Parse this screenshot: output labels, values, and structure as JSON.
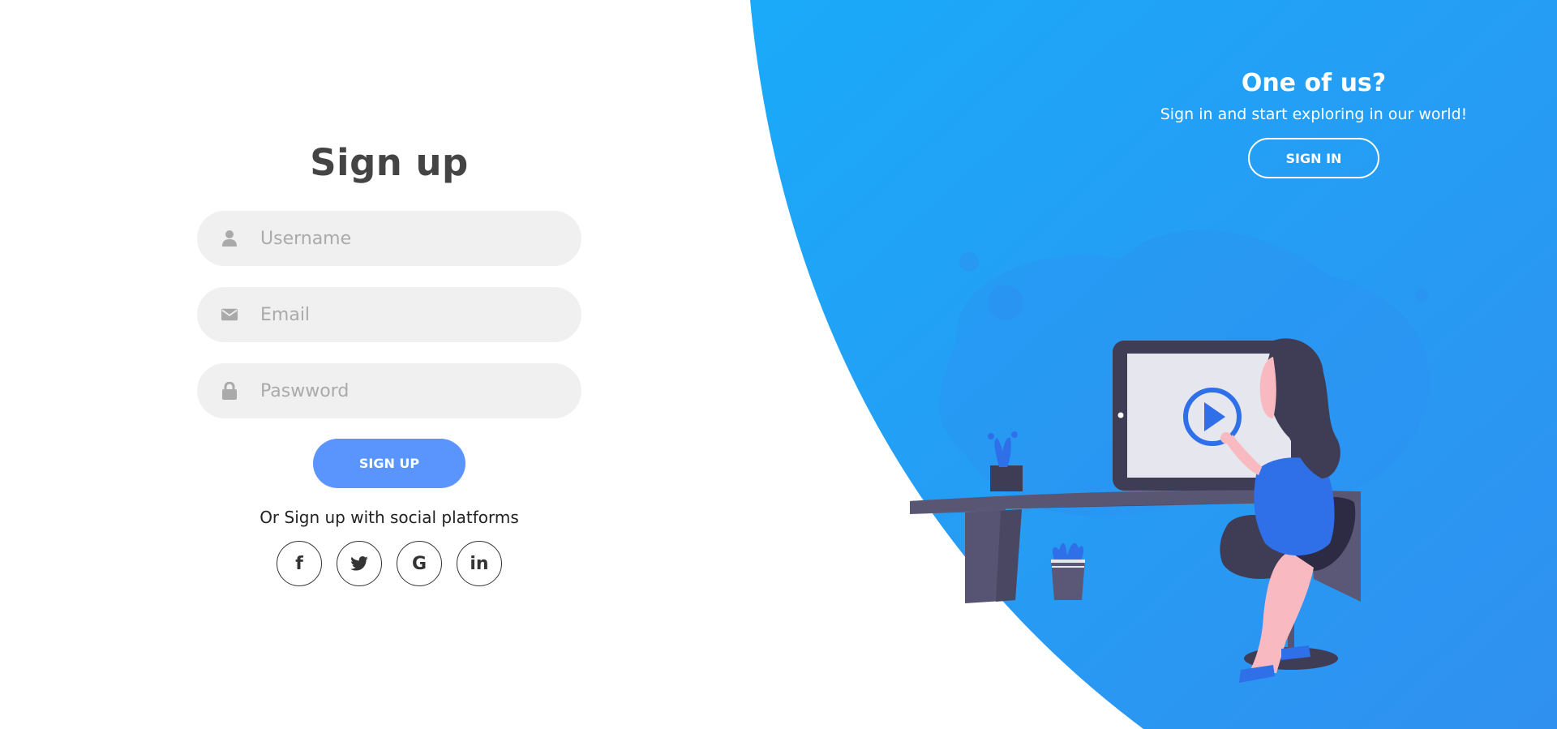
{
  "signup": {
    "title": "Sign up",
    "username_placeholder": "Username",
    "email_placeholder": "Email",
    "password_placeholder": "Paswword",
    "submit_label": "SIGN UP",
    "social_text": "Or Sign up with social platforms",
    "social": [
      {
        "name": "facebook",
        "glyph": "f"
      },
      {
        "name": "twitter",
        "glyph": ""
      },
      {
        "name": "google",
        "glyph": "G"
      },
      {
        "name": "linkedin",
        "glyph": "in"
      }
    ]
  },
  "panel": {
    "title": "One of us?",
    "subtitle": "Sign in and start exploring in our world!",
    "signin_label": "SIGN IN"
  },
  "colors": {
    "accent": "#5995fd",
    "panel_blue_light": "#1eaaf8",
    "panel_blue_dark": "#2e94f1",
    "field_bg": "#f0f0f0",
    "title": "#444444"
  }
}
